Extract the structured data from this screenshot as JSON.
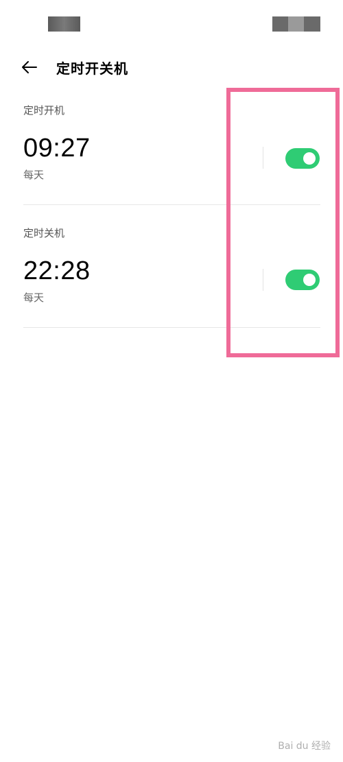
{
  "header": {
    "title": "定时开关机",
    "back_icon": "arrow-left-icon"
  },
  "power_on": {
    "label": "定时开机",
    "time": "09:27",
    "repeat": "每天",
    "enabled": true
  },
  "power_off": {
    "label": "定时关机",
    "time": "22:28",
    "repeat": "每天",
    "enabled": true
  },
  "watermark": {
    "text": "Bai du 经验"
  },
  "colors": {
    "toggle_on": "#2fcc74",
    "highlight_border": "#ef6b98"
  }
}
